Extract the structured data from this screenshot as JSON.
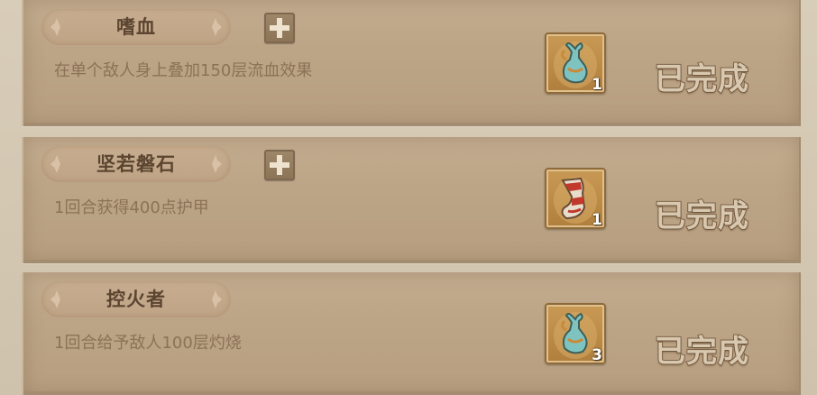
{
  "achievements": [
    {
      "title": "嗜血",
      "description": "在单个敌人身上叠加150层流血效果",
      "reward": {
        "icon": "vase-icon",
        "count": "1"
      },
      "status": "已完成"
    },
    {
      "title": "坚若磐石",
      "description": "1回合获得400点护甲",
      "reward": {
        "icon": "horn-icon",
        "count": "1"
      },
      "status": "已完成"
    },
    {
      "title": "控火者",
      "description": "1回合给予敌人100层灼烧",
      "reward": {
        "icon": "vase-icon",
        "count": "3"
      },
      "status": "已完成"
    }
  ],
  "colors": {
    "panel": "#bca486",
    "title_text": "#5b4530",
    "description_text": "#8b7258",
    "status_text": "#d9c8b0",
    "status_outline": "#7d6449"
  }
}
